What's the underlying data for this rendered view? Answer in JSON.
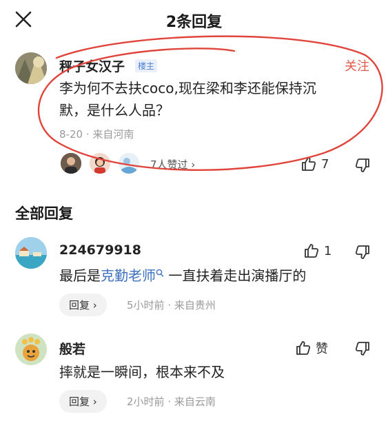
{
  "header": {
    "title": "2条回复"
  },
  "main_comment": {
    "username": "秤子女汉子",
    "op_badge": "楼主",
    "follow_label": "关注",
    "text_line1": "李为何不去扶coco,现在梁和李还能保持沉",
    "text_line2": "默，是什么人品？",
    "date": "8-20",
    "location": "来自河南",
    "likers_text": "7人赞过 ›",
    "like_count": "7"
  },
  "section": {
    "title": "全部回复"
  },
  "replies": [
    {
      "username": "224679918",
      "text_before": "最后是",
      "text_link": "克勤老师",
      "text_after": "一直扶着走出演播厅的",
      "reply_label": "回复 ›",
      "time": "5小时前",
      "location": "来自贵州",
      "like_count": "1"
    },
    {
      "username": "般若",
      "text": "摔就是一瞬间，根本来不及",
      "reply_label": "回复 ›",
      "time": "2小时前",
      "location": "来自云南",
      "like_label": "赞"
    }
  ],
  "colors": {
    "accent_red": "#e25a4a",
    "link_blue": "#3d6fbf",
    "op_badge": "#4d7fd6",
    "meta_gray": "#9a9a9a"
  }
}
